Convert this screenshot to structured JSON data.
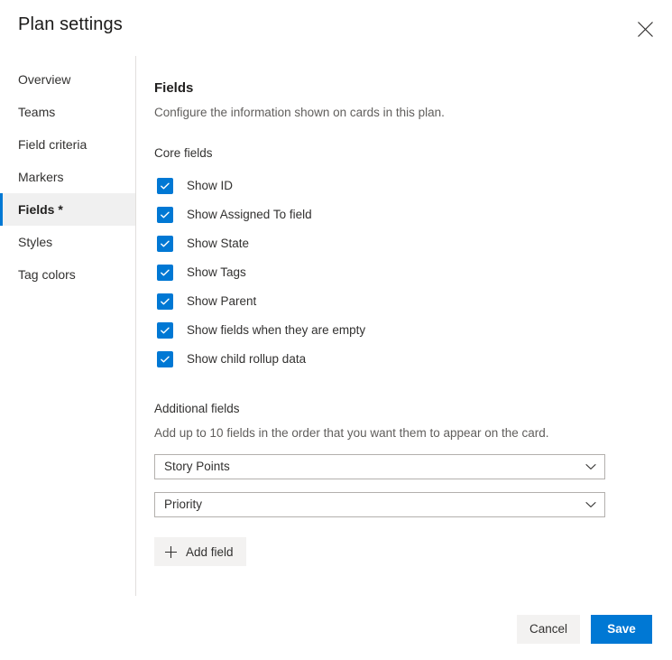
{
  "header": {
    "title": "Plan settings",
    "close_icon": "close-icon"
  },
  "sidebar": {
    "items": [
      {
        "label": "Overview",
        "selected": false
      },
      {
        "label": "Teams",
        "selected": false
      },
      {
        "label": "Field criteria",
        "selected": false
      },
      {
        "label": "Markers",
        "selected": false
      },
      {
        "label": "Fields *",
        "selected": true
      },
      {
        "label": "Styles",
        "selected": false
      },
      {
        "label": "Tag colors",
        "selected": false
      }
    ]
  },
  "content": {
    "section_title": "Fields",
    "section_desc": "Configure the information shown on cards in this plan.",
    "core_fields": {
      "label": "Core fields",
      "items": [
        {
          "label": "Show ID",
          "checked": true
        },
        {
          "label": "Show Assigned To field",
          "checked": true
        },
        {
          "label": "Show State",
          "checked": true
        },
        {
          "label": "Show Tags",
          "checked": true
        },
        {
          "label": "Show Parent",
          "checked": true
        },
        {
          "label": "Show fields when they are empty",
          "checked": true
        },
        {
          "label": "Show child rollup data",
          "checked": true
        }
      ]
    },
    "additional_fields": {
      "label": "Additional fields",
      "desc": "Add up to 10 fields in the order that you want them to appear on the card.",
      "selects": [
        {
          "value": "Story Points",
          "chevron_icon": "chevron-down-icon"
        },
        {
          "value": "Priority",
          "chevron_icon": "chevron-down-icon"
        }
      ],
      "add_field_label": "Add field",
      "add_field_icon": "plus-icon"
    }
  },
  "footer": {
    "cancel_label": "Cancel",
    "save_label": "Save"
  },
  "colors": {
    "accent": "#0078d4",
    "selected_row_bg": "#f0f0f0",
    "neutral_button_bg": "#f3f2f1",
    "divider": "#e1dfdd",
    "secondary_text": "#605e5c"
  }
}
